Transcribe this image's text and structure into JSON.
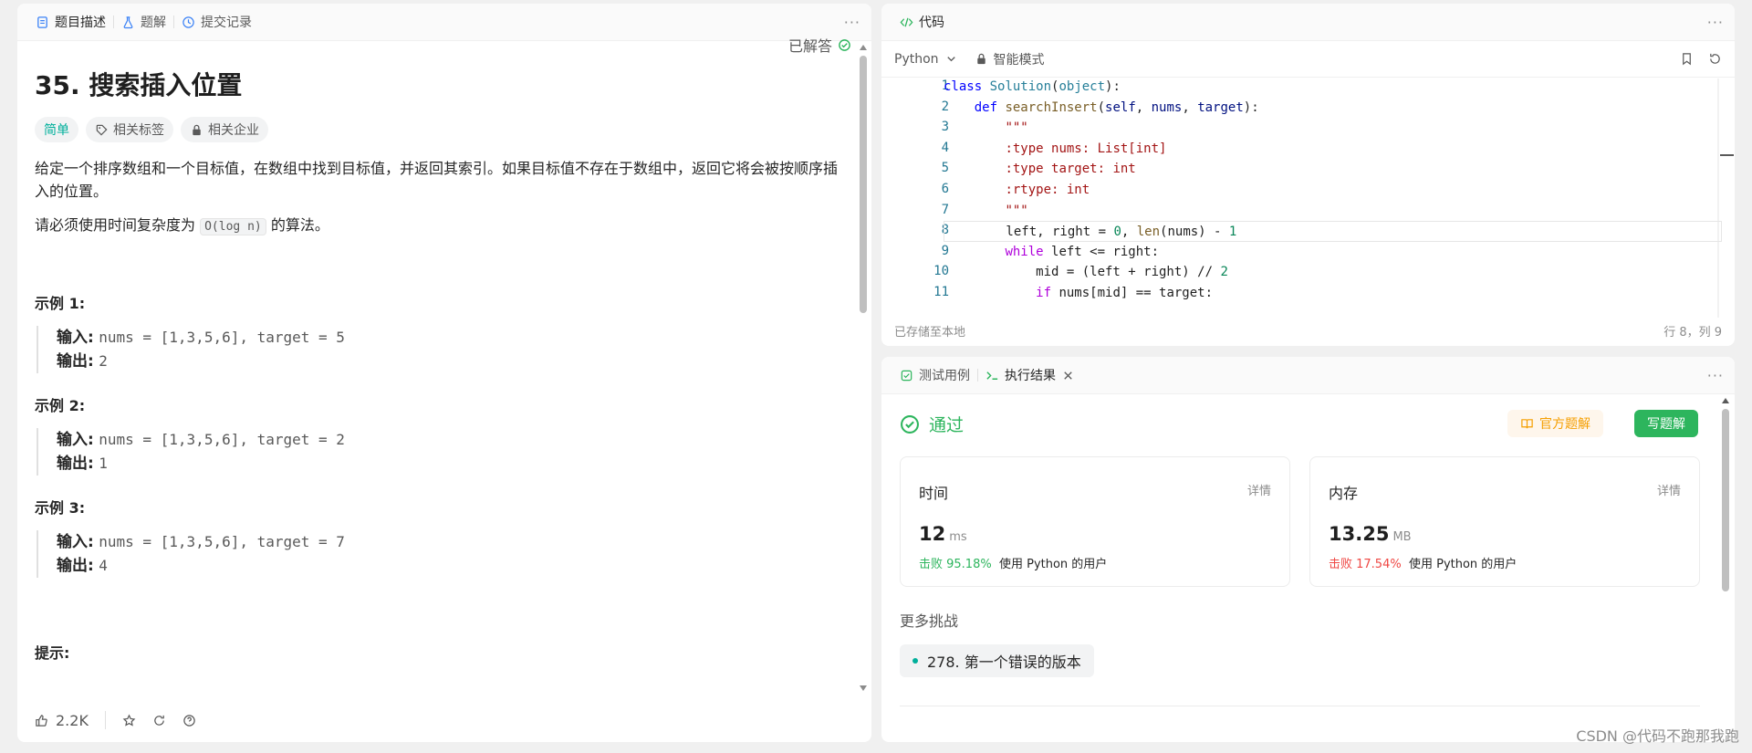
{
  "left": {
    "tabs": [
      "题目描述",
      "题解",
      "提交记录"
    ],
    "title": "35. 搜索插入位置",
    "solved": "已解答",
    "tags": [
      "简单",
      "相关标签",
      "相关企业"
    ],
    "desc1": "给定一个排序数组和一个目标值，在数组中找到目标值，并返回其索引。如果目标值不存在于数组中，返回它将会被按顺序插入的位置。",
    "desc2_pre": "请必须使用时间复杂度为",
    "desc2_code": "O(log n)",
    "desc2_post": "的算法。",
    "examples": [
      {
        "title": "示例 1:",
        "input_label": "输入:",
        "input": "nums = [1,3,5,6], target = 5",
        "output_label": "输出:",
        "output": "2"
      },
      {
        "title": "示例 2:",
        "input_label": "输入:",
        "input": "nums = [1,3,5,6], target = 2",
        "output_label": "输出:",
        "output": "1"
      },
      {
        "title": "示例 3:",
        "input_label": "输入:",
        "input": "nums = [1,3,5,6], target = 7",
        "output_label": "输出:",
        "output": "4"
      }
    ],
    "hint": "提示:",
    "likes": "2.2K"
  },
  "code": {
    "tab": "代码",
    "language": "Python",
    "mode": "智能模式",
    "saved": "已存储至本地",
    "cursor": "行 8，列 9",
    "lines": [
      "class Solution(object):",
      "    def searchInsert(self, nums, target):",
      "        \"\"\"",
      "        :type nums: List[int]",
      "        :type target: int",
      "        :rtype: int",
      "        \"\"\"",
      "        left, right = 0, len(nums) - 1",
      "        while left <= right:",
      "            mid = (left + right) // 2",
      "            if nums[mid] == target:"
    ]
  },
  "result": {
    "tabs": [
      "测试用例",
      "执行结果"
    ],
    "status": "通过",
    "official_btn": "官方题解",
    "write_btn": "写题解",
    "time": {
      "label": "时间",
      "detail": "详情",
      "value": "12",
      "unit": "ms",
      "beat_pct": "击败 95.18%",
      "beat_text": "使用 Python 的用户"
    },
    "memory": {
      "label": "内存",
      "detail": "详情",
      "value": "13.25",
      "unit": "MB",
      "beat_pct": "击败 17.54%",
      "beat_text": "使用 Python 的用户"
    },
    "more_title": "更多挑战",
    "challenge": "278. 第一个错误的版本"
  },
  "watermark": "CSDN @代码不跑那我跑"
}
